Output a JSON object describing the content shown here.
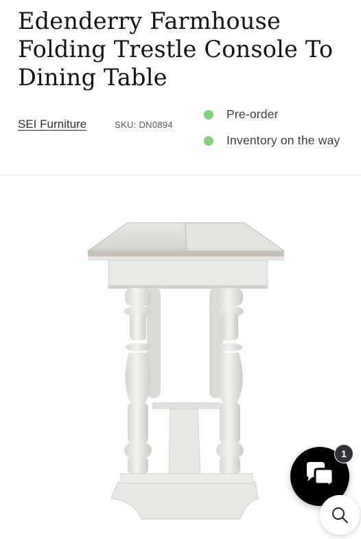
{
  "product": {
    "title": "Edenderry Farmhouse Folding Trestle Console To Dining Table",
    "vendor": "SEI Furniture",
    "sku": "SKU: DN0894"
  },
  "statuses": [
    {
      "label": "Pre-order",
      "color": "#7fd37a"
    },
    {
      "label": "Inventory on the way",
      "color": "#7fd37a"
    }
  ],
  "media": {
    "image_alt": "White folding trestle console table"
  },
  "chat": {
    "badge_count": "1",
    "icon": "chat-bubbles-icon"
  },
  "search": {
    "icon": "search-icon"
  }
}
